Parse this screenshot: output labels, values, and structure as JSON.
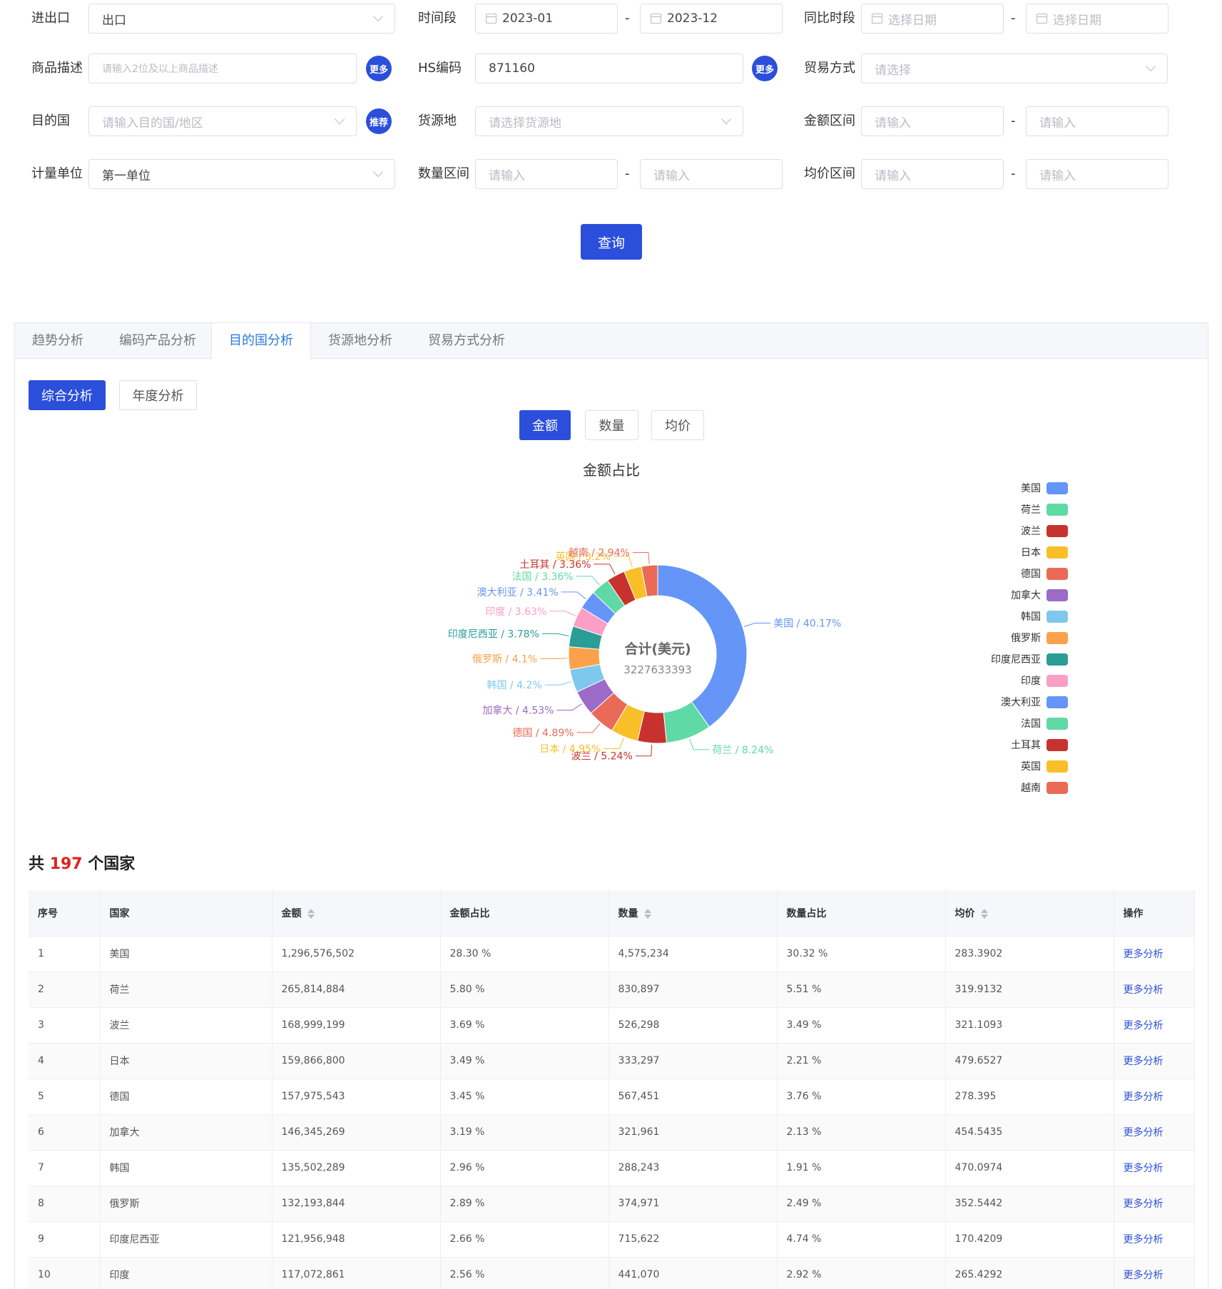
{
  "filters": {
    "trade_dir": {
      "label": "进出口",
      "value": "出口"
    },
    "period": {
      "label": "时间段",
      "start": "2023-01",
      "end": "2023-12",
      "sep": "-"
    },
    "compare_period": {
      "label": "同比时段",
      "start_placeholder": "选择日期",
      "end_placeholder": "选择日期",
      "sep": "-"
    },
    "goods_desc": {
      "label": "商品描述",
      "placeholder": "请输入2位及以上商品描述",
      "more": "更多"
    },
    "hs_code": {
      "label": "HS编码",
      "value": "871160",
      "more": "更多"
    },
    "trade_mode": {
      "label": "贸易方式",
      "placeholder": "请选择"
    },
    "dest_country": {
      "label": "目的国",
      "placeholder": "请输入目的国/地区",
      "recommend": "推荐"
    },
    "origin": {
      "label": "货源地",
      "placeholder": "请选择货源地"
    },
    "amount_range": {
      "label": "金额区间",
      "min_placeholder": "请输入",
      "max_placeholder": "请输入",
      "sep": "-"
    },
    "unit": {
      "label": "计量单位",
      "value": "第一单位"
    },
    "qty_range": {
      "label": "数量区间",
      "min_placeholder": "请输入",
      "max_placeholder": "请输入",
      "sep": "-"
    },
    "price_range": {
      "label": "均价区间",
      "min_placeholder": "请输入",
      "max_placeholder": "请输入",
      "sep": "-"
    },
    "query_label": "查询"
  },
  "tabs": [
    "趋势分析",
    "编码产品分析",
    "目的国分析",
    "货源地分析",
    "贸易方式分析"
  ],
  "active_tab": 2,
  "subtabs": [
    "综合分析",
    "年度分析"
  ],
  "metric_tabs": [
    "金额",
    "数量",
    "均价"
  ],
  "chart_data": {
    "type": "pie",
    "title": "金额占比",
    "center_label": "合计(美元)",
    "center_value": "3227633393",
    "legend_position": "right",
    "slices": [
      {
        "name": "美国",
        "value": 40.17,
        "color": "#6495f7"
      },
      {
        "name": "荷兰",
        "value": 8.24,
        "color": "#5fd9a6"
      },
      {
        "name": "波兰",
        "value": 5.24,
        "color": "#c8322e"
      },
      {
        "name": "日本",
        "value": 4.95,
        "color": "#f8bf28"
      },
      {
        "name": "德国",
        "value": 4.89,
        "color": "#ea6a57"
      },
      {
        "name": "加拿大",
        "value": 4.53,
        "color": "#9b6bc7"
      },
      {
        "name": "韩国",
        "value": 4.2,
        "color": "#7ec8ee"
      },
      {
        "name": "俄罗斯",
        "value": 4.1,
        "color": "#fba14b"
      },
      {
        "name": "印度尼西亚",
        "value": 3.78,
        "color": "#2a9d96"
      },
      {
        "name": "印度",
        "value": 3.63,
        "color": "#fc9ec6"
      },
      {
        "name": "澳大利亚",
        "value": 3.41,
        "color": "#6495f7"
      },
      {
        "name": "法国",
        "value": 3.36,
        "color": "#5fd9a6"
      },
      {
        "name": "土耳其",
        "value": 3.36,
        "color": "#c8322e"
      },
      {
        "name": "英国",
        "value": 3.2,
        "color": "#f8bf28"
      },
      {
        "name": "越南",
        "value": 2.94,
        "color": "#ea6a57"
      }
    ],
    "labels": [
      "美国 / 40.17%",
      "荷兰 / 8.24%",
      "波兰 / 5.24%",
      "日本 / 4.95%",
      "德国 / 4.89%",
      "加拿大 / 4.53%",
      "韩国 / 4.2%",
      "俄罗斯 / 4.1%",
      "印度尼西亚 / 3.78%",
      "印度 / 3.63%",
      "澳大利亚 / 3.41%",
      "法国 / 3.36%",
      "土耳其 / 3.36%",
      "英国 / 3.2%",
      "越南 / 2.94%"
    ]
  },
  "summary": {
    "prefix": "共",
    "count": "197",
    "suffix": "个国家"
  },
  "table": {
    "columns": [
      "序号",
      "国家",
      "金额",
      "金额占比",
      "数量",
      "数量占比",
      "均价",
      "操作"
    ],
    "action_label": "更多分析",
    "rows": [
      [
        "1",
        "美国",
        "1,296,576,502",
        "28.30 %",
        "4,575,234",
        "30.32 %",
        "283.3902"
      ],
      [
        "2",
        "荷兰",
        "265,814,884",
        "5.80 %",
        "830,897",
        "5.51 %",
        "319.9132"
      ],
      [
        "3",
        "波兰",
        "168,999,199",
        "3.69 %",
        "526,298",
        "3.49 %",
        "321.1093"
      ],
      [
        "4",
        "日本",
        "159,866,800",
        "3.49 %",
        "333,297",
        "2.21 %",
        "479.6527"
      ],
      [
        "5",
        "德国",
        "157,975,543",
        "3.45 %",
        "567,451",
        "3.76 %",
        "278.395"
      ],
      [
        "6",
        "加拿大",
        "146,345,269",
        "3.19 %",
        "321,961",
        "2.13 %",
        "454.5435"
      ],
      [
        "7",
        "韩国",
        "135,502,289",
        "2.96 %",
        "288,243",
        "1.91 %",
        "470.0974"
      ],
      [
        "8",
        "俄罗斯",
        "132,193,844",
        "2.89 %",
        "374,971",
        "2.49 %",
        "352.5442"
      ],
      [
        "9",
        "印度尼西亚",
        "121,956,948",
        "2.66 %",
        "715,622",
        "4.74 %",
        "170.4209"
      ],
      [
        "10",
        "印度",
        "117,072,861",
        "2.56 %",
        "441,070",
        "2.92 %",
        "265.4292"
      ]
    ]
  }
}
